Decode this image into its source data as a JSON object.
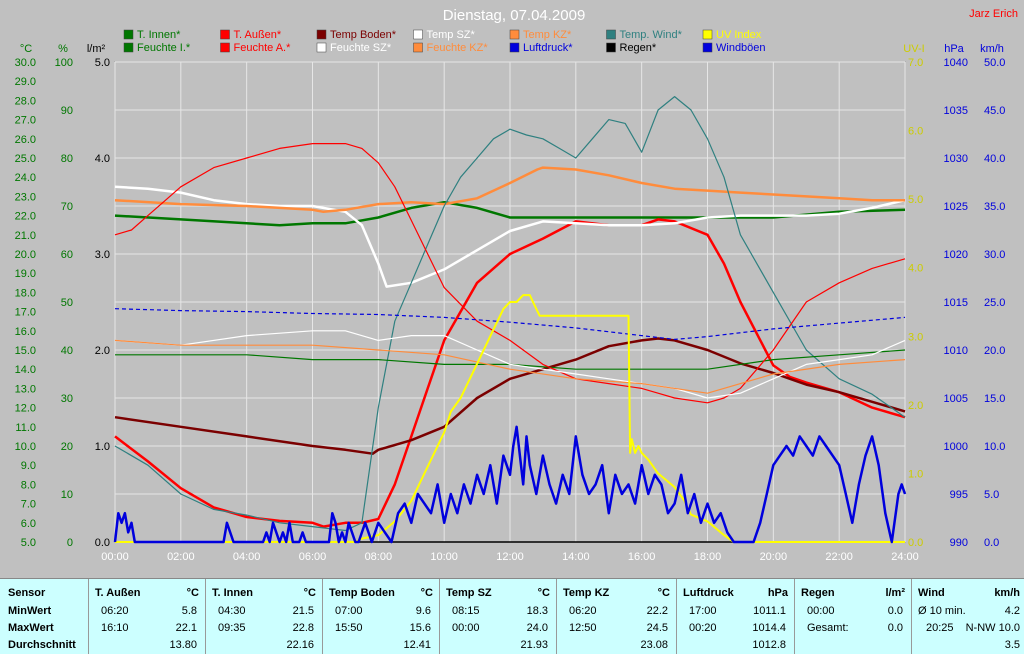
{
  "title": "Dienstag, 07.04.2009",
  "author": "Jarz Erich",
  "colors": {
    "background": "#c0c0c0",
    "plot": "#c0c0c0",
    "grid": "#e8e8e8",
    "green_axis": "#007700",
    "blue_axis": "#0000dd",
    "yellow_axis": "#cccc00",
    "red": "#ff0000"
  },
  "legend": [
    {
      "label": "T. Innen*",
      "color": "#007700"
    },
    {
      "label": "T. Außen*",
      "color": "#ff0000"
    },
    {
      "label": "Temp Boden*",
      "color": "#7b0000"
    },
    {
      "label": "Temp SZ*",
      "color": "#ffffff"
    },
    {
      "label": "Temp KZ*",
      "color": "#ff8c3c"
    },
    {
      "label": "Temp. Wind*",
      "color": "#2f8080"
    },
    {
      "label": "UV Index",
      "color": "#ffff00"
    },
    {
      "label": "Feuchte I.*",
      "color": "#007700"
    },
    {
      "label": "Feuchte A.*",
      "color": "#ff0000"
    },
    {
      "label": "Feuchte SZ*",
      "color": "#ffffff"
    },
    {
      "label": "Feuchte KZ*",
      "color": "#ff8c3c"
    },
    {
      "label": "Luftdruck*",
      "color": "#0000dd"
    },
    {
      "label": "Regen*",
      "color": "#000000"
    },
    {
      "label": "Windböen",
      "color": "#0000dd"
    }
  ],
  "axes": {
    "temp": {
      "unit": "°C",
      "min": 5.0,
      "max": 30.0,
      "ticks": [
        "30.0",
        "29.0",
        "28.0",
        "27.0",
        "26.0",
        "25.0",
        "24.0",
        "23.0",
        "22.0",
        "21.0",
        "20.0",
        "19.0",
        "18.0",
        "17.0",
        "16.0",
        "15.0",
        "14.0",
        "13.0",
        "12.0",
        "11.0",
        "10.0",
        "9.0",
        "8.0",
        "7.0",
        "6.0",
        "5.0"
      ]
    },
    "humidity": {
      "unit": "%",
      "min": 0,
      "max": 100,
      "ticks": [
        "100",
        "90",
        "80",
        "70",
        "60",
        "50",
        "40",
        "30",
        "20",
        "10",
        "0"
      ]
    },
    "rain": {
      "unit": "l/m²",
      "min": 0,
      "max": 5,
      "ticks": [
        "5.0",
        "4.0",
        "3.0",
        "2.0",
        "1.0",
        "0.0"
      ]
    },
    "uv": {
      "unit": "UV-I",
      "min": 0,
      "max": 7,
      "ticks": [
        "7.0",
        "6.0",
        "5.0",
        "4.0",
        "3.0",
        "2.0",
        "1.0",
        "0.0"
      ]
    },
    "pressure": {
      "unit": "hPa",
      "min": 990,
      "max": 1040,
      "ticks": [
        "1040",
        "1035",
        "1030",
        "1025",
        "1020",
        "1015",
        "1010",
        "1005",
        "1000",
        "995",
        "990"
      ]
    },
    "wind": {
      "unit": "km/h",
      "min": 0,
      "max": 50,
      "ticks": [
        "50.0",
        "45.0",
        "40.0",
        "35.0",
        "30.0",
        "25.0",
        "20.0",
        "15.0",
        "10.0",
        "5.0",
        "0.0"
      ]
    },
    "time_ticks": [
      "00:00",
      "02:00",
      "04:00",
      "06:00",
      "08:00",
      "10:00",
      "12:00",
      "14:00",
      "16:00",
      "18:00",
      "20:00",
      "22:00",
      "24:00"
    ]
  },
  "chart_data": {
    "type": "line",
    "title": "Dienstag, 07.04.2009",
    "x_unit": "hour",
    "x_range": [
      0,
      24
    ],
    "series": [
      {
        "name": "T. Innen*",
        "axis": "temp",
        "color": "#007700",
        "width": 2.5,
        "x": [
          0,
          2,
          4,
          5,
          6,
          7,
          8,
          9,
          10,
          11,
          12,
          13,
          14,
          16,
          18,
          20,
          22,
          24
        ],
        "y": [
          22.0,
          21.8,
          21.6,
          21.5,
          21.6,
          21.6,
          21.9,
          22.4,
          22.7,
          22.4,
          21.9,
          21.9,
          21.9,
          21.9,
          21.9,
          21.9,
          22.2,
          22.3
        ]
      },
      {
        "name": "T. Außen*",
        "axis": "temp",
        "color": "#ff0000",
        "width": 2.5,
        "x": [
          0,
          1,
          2,
          3,
          4,
          5,
          6,
          6.33,
          7,
          7.5,
          8,
          8.5,
          9,
          9.5,
          10,
          11,
          12,
          13,
          14,
          15,
          16,
          16.5,
          17,
          18,
          18.5,
          19,
          20,
          20.5,
          21,
          22,
          23,
          24
        ],
        "y": [
          10.5,
          9.2,
          7.8,
          6.8,
          6.3,
          6.1,
          6.0,
          5.8,
          6.0,
          6.0,
          6.2,
          8.0,
          10.5,
          13.0,
          15.5,
          18.5,
          20.0,
          20.8,
          21.7,
          21.5,
          21.5,
          21.8,
          21.7,
          21.0,
          19.5,
          17.5,
          14.2,
          13.6,
          13.3,
          12.8,
          12.0,
          11.5
        ]
      },
      {
        "name": "Temp Boden*",
        "axis": "temp",
        "color": "#7b0000",
        "width": 2.5,
        "x": [
          0,
          2,
          4,
          6,
          7,
          7.83,
          8,
          9,
          10,
          11,
          12,
          13,
          14,
          15,
          16,
          16.5,
          17,
          18,
          19,
          20,
          21,
          22,
          23,
          24
        ],
        "y": [
          11.5,
          11.0,
          10.5,
          10.0,
          9.8,
          9.6,
          9.8,
          10.3,
          11.0,
          12.5,
          13.5,
          14.0,
          14.5,
          15.2,
          15.5,
          15.6,
          15.5,
          15.0,
          14.3,
          13.8,
          13.2,
          12.8,
          12.3,
          11.8
        ]
      },
      {
        "name": "Temp SZ*",
        "axis": "temp",
        "color": "#ffffff",
        "width": 2.5,
        "x": [
          0,
          1,
          2,
          3,
          4,
          5,
          6,
          7,
          7.5,
          8,
          8.25,
          9,
          10,
          11,
          12,
          13,
          14,
          15,
          16,
          17,
          18,
          19,
          20,
          21,
          22,
          23,
          24
        ],
        "y": [
          23.5,
          23.4,
          23.2,
          22.8,
          22.6,
          22.5,
          22.5,
          22.2,
          21.5,
          19.5,
          18.3,
          18.5,
          19.2,
          20.2,
          21.2,
          21.7,
          21.6,
          21.5,
          21.5,
          21.6,
          21.9,
          22.0,
          22.0,
          22.0,
          22.1,
          22.4,
          22.8
        ]
      },
      {
        "name": "Temp KZ*",
        "axis": "temp",
        "color": "#ff8c3c",
        "width": 2.5,
        "x": [
          0,
          2,
          4,
          6,
          6.33,
          7,
          8,
          9,
          10,
          11,
          12,
          12.83,
          13,
          14,
          15,
          16,
          17,
          18,
          19,
          20,
          21,
          22,
          23,
          24
        ],
        "y": [
          22.8,
          22.6,
          22.5,
          22.3,
          22.2,
          22.3,
          22.6,
          22.7,
          22.6,
          22.9,
          23.7,
          24.4,
          24.5,
          24.4,
          24.1,
          23.7,
          23.4,
          23.3,
          23.2,
          23.1,
          23.0,
          22.9,
          22.8,
          22.8
        ]
      },
      {
        "name": "Temp. Wind*",
        "axis": "temp",
        "color": "#2f8080",
        "width": 1.2,
        "x": [
          0,
          1,
          2,
          3,
          4,
          5,
          6,
          7,
          7.5,
          8,
          8.5,
          9,
          9.5,
          10,
          10.5,
          11,
          11.5,
          12,
          12.5,
          13,
          13.5,
          14,
          14.5,
          15,
          15.5,
          16,
          16.5,
          17,
          17.5,
          18,
          18.5,
          19,
          20,
          21,
          22,
          23,
          24
        ],
        "y": [
          10.0,
          9.0,
          7.5,
          6.7,
          6.4,
          6.0,
          5.8,
          5.6,
          6.0,
          12.0,
          16.5,
          18.5,
          20.5,
          22.5,
          24.0,
          25.0,
          26.0,
          26.5,
          26.2,
          26.0,
          25.5,
          25.0,
          26.0,
          27.0,
          26.8,
          25.3,
          27.5,
          28.2,
          27.5,
          26.0,
          24.0,
          21.0,
          18.0,
          15.0,
          13.5,
          12.7,
          11.5
        ]
      },
      {
        "name": "Feuchte I.*",
        "axis": "humidity",
        "color": "#007700",
        "width": 1.2,
        "x": [
          0,
          2,
          4,
          6,
          8,
          10,
          12,
          14,
          16,
          18,
          20,
          22,
          24
        ],
        "y": [
          39,
          39,
          39,
          38,
          38,
          37,
          37,
          36,
          36,
          36,
          38,
          39,
          40
        ]
      },
      {
        "name": "Feuchte A.*",
        "axis": "humidity",
        "color": "#ff0000",
        "width": 1.2,
        "x": [
          0,
          0.5,
          1,
          1.5,
          2,
          3,
          4,
          5,
          6,
          7,
          7.5,
          8,
          8.5,
          9,
          9.5,
          10,
          11,
          12,
          13,
          14,
          15,
          16,
          16.5,
          17,
          18,
          18.5,
          19,
          20,
          21,
          22,
          23,
          24
        ],
        "y": [
          64,
          65,
          68,
          71,
          74,
          78,
          80,
          82,
          83,
          83,
          82,
          79,
          74,
          67,
          60,
          53,
          46,
          42,
          37,
          34,
          33,
          32,
          31,
          30,
          29,
          30,
          32,
          40,
          50,
          54,
          57,
          59
        ]
      },
      {
        "name": "Feuchte SZ*",
        "axis": "humidity",
        "color": "#ffffff",
        "width": 1.2,
        "x": [
          0,
          2,
          4,
          6,
          7,
          8,
          9,
          10,
          11,
          12,
          13,
          14,
          15,
          16,
          17,
          18,
          19,
          20,
          21,
          22,
          23,
          24
        ],
        "y": [
          42,
          41,
          43,
          44,
          44,
          42,
          43,
          43,
          40,
          37,
          36,
          35,
          34,
          33,
          32,
          30,
          31,
          34,
          37,
          38,
          39,
          42
        ]
      },
      {
        "name": "Feuchte KZ*",
        "axis": "humidity",
        "color": "#ff8c3c",
        "width": 1.2,
        "x": [
          0,
          2,
          4,
          6,
          8,
          10,
          12,
          14,
          16,
          18,
          20,
          22,
          24
        ],
        "y": [
          42,
          41,
          41,
          41,
          40,
          39,
          36,
          34,
          33,
          31,
          35,
          37,
          38
        ]
      },
      {
        "name": "Luftdruck*",
        "axis": "pressure",
        "color": "#0000dd",
        "width": 1.2,
        "dash": "4,3",
        "x": [
          0,
          2,
          4,
          6,
          8,
          10,
          12,
          14,
          16,
          17,
          18,
          20,
          22,
          24
        ],
        "y": [
          1014.3,
          1014.1,
          1014.0,
          1013.8,
          1013.7,
          1013.4,
          1012.9,
          1012.3,
          1011.5,
          1011.1,
          1011.4,
          1012.2,
          1012.8,
          1013.4
        ]
      },
      {
        "name": "Regen*",
        "axis": "rain",
        "color": "#000000",
        "width": 1.5,
        "x": [
          0,
          24
        ],
        "y": [
          0,
          0
        ]
      },
      {
        "name": "UV Index",
        "axis": "uv",
        "color": "#ffff00",
        "width": 2,
        "x": [
          0,
          7.3,
          7.5,
          8.0,
          8.5,
          9.0,
          9.3,
          9.5,
          9.7,
          10.0,
          10.2,
          10.5,
          10.8,
          11.0,
          11.3,
          11.5,
          11.8,
          12.0,
          12.2,
          12.4,
          12.6,
          12.7,
          12.9,
          13.0,
          14.0,
          15.0,
          15.6,
          15.65,
          15.7,
          15.8,
          15.9,
          16.0,
          16.2,
          16.5,
          17.0,
          17.3,
          17.5,
          18.0,
          18.5,
          18.8,
          24
        ],
        "y": [
          0,
          0,
          0.05,
          0.1,
          0.3,
          0.6,
          0.9,
          1.1,
          1.3,
          1.6,
          1.9,
          2.1,
          2.4,
          2.6,
          2.9,
          3.1,
          3.4,
          3.5,
          3.5,
          3.6,
          3.6,
          3.5,
          3.3,
          3.3,
          3.3,
          3.3,
          3.3,
          1.3,
          1.5,
          1.3,
          1.4,
          1.3,
          1.2,
          1.0,
          0.8,
          0.6,
          0.4,
          0.3,
          0.1,
          0,
          0
        ]
      },
      {
        "name": "Windböen",
        "axis": "wind",
        "color": "#0000dd",
        "width": 2.5,
        "x": [
          0,
          0.1,
          0.2,
          0.3,
          0.4,
          0.5,
          0.6,
          3.3,
          3.4,
          3.5,
          3.6,
          4.5,
          4.6,
          4.7,
          4.8,
          5.0,
          5.1,
          5.2,
          5.3,
          5.4,
          5.6,
          5.7,
          5.8,
          5.9,
          6.5,
          6.6,
          6.7,
          6.8,
          6.9,
          7.0,
          7.1,
          7.2,
          7.3,
          7.4,
          7.5,
          7.6,
          7.8,
          8.0,
          8.2,
          8.4,
          8.6,
          8.8,
          9.0,
          9.2,
          9.4,
          9.6,
          9.8,
          10.0,
          10.2,
          10.4,
          10.6,
          10.8,
          11.0,
          11.2,
          11.4,
          11.6,
          11.8,
          12.0,
          12.1,
          12.2,
          12.3,
          12.4,
          12.5,
          12.6,
          12.8,
          13.0,
          13.2,
          13.4,
          13.6,
          13.8,
          14.0,
          14.2,
          14.4,
          14.6,
          14.8,
          15.0,
          15.2,
          15.4,
          15.6,
          15.8,
          16.0,
          16.2,
          16.4,
          16.6,
          16.8,
          17.0,
          17.2,
          17.4,
          17.6,
          17.8,
          18.0,
          18.2,
          18.4,
          18.6,
          18.8,
          19.0,
          19.2,
          19.4,
          19.6,
          19.8,
          20.0,
          20.2,
          20.4,
          20.6,
          20.8,
          21.0,
          21.2,
          21.4,
          21.6,
          21.8,
          22.0,
          22.2,
          22.4,
          22.6,
          22.8,
          23.0,
          23.2,
          23.4,
          23.6,
          23.8,
          23.9,
          24.0
        ],
        "y": [
          0,
          3,
          2,
          3,
          1,
          2,
          0,
          0,
          2,
          1,
          0,
          0,
          1,
          0,
          2,
          0,
          1,
          0,
          2,
          0,
          0,
          1,
          0,
          0,
          0,
          3,
          2,
          0,
          1,
          0,
          2,
          1,
          0,
          0,
          1,
          2,
          0,
          2,
          1,
          0,
          3,
          4,
          2,
          5,
          4,
          3,
          6,
          2,
          5,
          3,
          6,
          4,
          7,
          5,
          8,
          4,
          9,
          7,
          10,
          12,
          9,
          6,
          11,
          8,
          5,
          9,
          6,
          4,
          7,
          5,
          11,
          7,
          5,
          6,
          8,
          3,
          7,
          5,
          6,
          4,
          8,
          5,
          7,
          6,
          3,
          4,
          7,
          3,
          5,
          2,
          4,
          2,
          3,
          1,
          0,
          0,
          0,
          0,
          2,
          5,
          8,
          9,
          10,
          9,
          11,
          10,
          9,
          11,
          10,
          9,
          8,
          5,
          2,
          6,
          9,
          11,
          8,
          3,
          0,
          5,
          6,
          5
        ]
      }
    ]
  },
  "stats": [
    {
      "sensor": "Sensor",
      "min_label": "MinWert",
      "max_label": "MaxWert",
      "avg_label": "Durchschnitt"
    },
    {
      "name": "T. Außen",
      "unit": "°C",
      "min_time": "06:20",
      "min_val": "5.8",
      "max_time": "16:10",
      "max_val": "22.1",
      "avg": "13.80"
    },
    {
      "name": "T. Innen",
      "unit": "°C",
      "min_time": "04:30",
      "min_val": "21.5",
      "max_time": "09:35",
      "max_val": "22.8",
      "avg": "22.16"
    },
    {
      "name": "Temp Boden",
      "unit": "°C",
      "min_time": "07:00",
      "min_val": "9.6",
      "max_time": "15:50",
      "max_val": "15.6",
      "avg": "12.41"
    },
    {
      "name": "Temp SZ",
      "unit": "°C",
      "min_time": "08:15",
      "min_val": "18.3",
      "max_time": "00:00",
      "max_val": "24.0",
      "avg": "21.93"
    },
    {
      "name": "Temp KZ",
      "unit": "°C",
      "min_time": "06:20",
      "min_val": "22.2",
      "max_time": "12:50",
      "max_val": "24.5",
      "avg": "23.08"
    },
    {
      "name": "Luftdruck",
      "unit": "hPa",
      "min_time": "17:00",
      "min_val": "1011.1",
      "max_time": "00:20",
      "max_val": "1014.4",
      "avg": "1012.8"
    },
    {
      "name": "Regen",
      "unit": "l/m²",
      "min_time": "00:00",
      "min_val": "0.0",
      "max_time": "Gesamt:",
      "max_val": "0.0",
      "avg": ""
    },
    {
      "name": "Wind",
      "unit": "km/h",
      "min_time": "Ø 10 min.",
      "min_val": "4.2",
      "max_time": "20:25",
      "max_val": "N-NW 10.0",
      "avg": "3.5"
    }
  ]
}
